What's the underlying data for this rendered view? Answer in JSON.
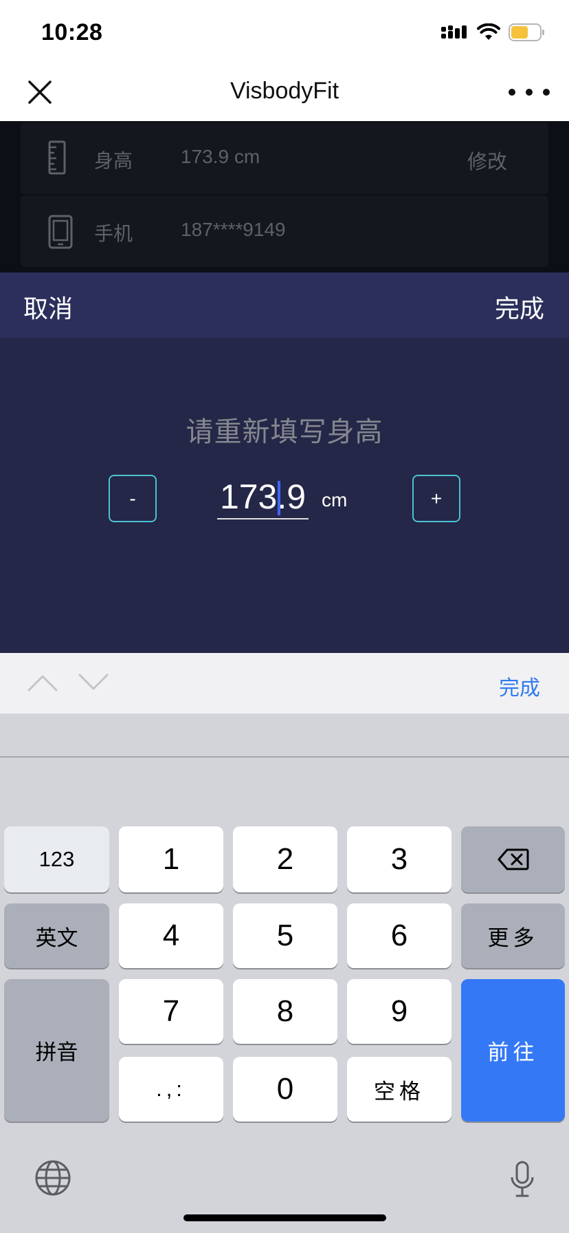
{
  "status_bar": {
    "time": "10:28",
    "battery_color": "#f5c23c"
  },
  "nav": {
    "title": "VisbodyFit",
    "close_icon": "close-icon",
    "more_icon": "more-icon"
  },
  "profile": {
    "rows": [
      {
        "label": "身高",
        "value": "173.9 cm",
        "action": "修改",
        "icon": "ruler-icon"
      },
      {
        "label": "手机",
        "value": "187****9149",
        "icon": "phone-icon"
      }
    ]
  },
  "sheet": {
    "cancel_label": "取消",
    "done_label": "完成",
    "prompt": "请重新填写身高",
    "minus_label": "-",
    "plus_label": "+",
    "height_value": "173.9",
    "unit": "cm",
    "accent_color": "#4cc3d4",
    "header_color": "#2c2f5b",
    "body_color": "#242747"
  },
  "keyboard_accessory": {
    "done_label": "完成",
    "done_color": "#2f7bf0"
  },
  "keyboard": {
    "mode_123": "123",
    "english": "英文",
    "pinyin": "拼音",
    "more": "更多",
    "go": "前往",
    "space": "空格",
    "punct": ".,:",
    "digits": [
      "1",
      "2",
      "3",
      "4",
      "5",
      "6",
      "7",
      "8",
      "9",
      "0"
    ],
    "go_color": "#3478f6"
  }
}
